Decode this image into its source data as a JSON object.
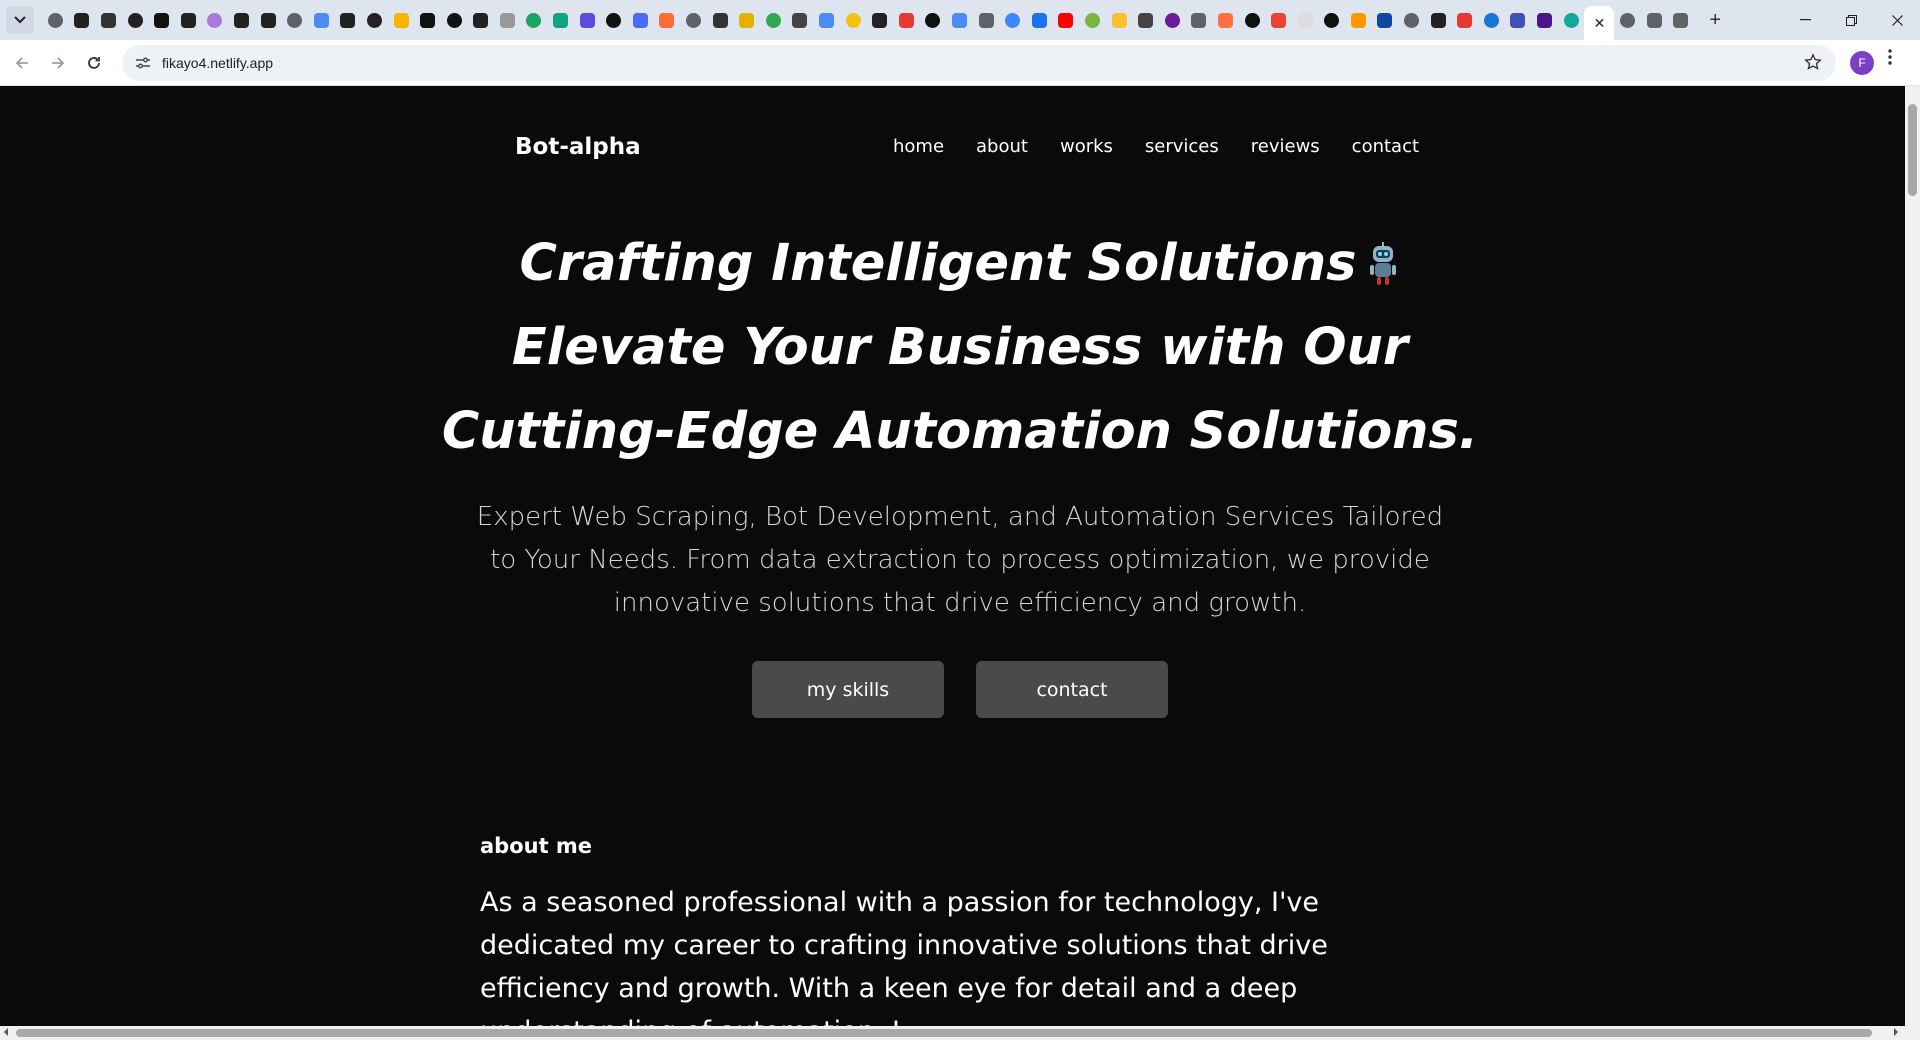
{
  "browser": {
    "url": "fikayo4.netlify.app",
    "tab_close_glyph": "✕",
    "new_tab_glyph": "+",
    "profile_initial": "F",
    "tab_icon_colors": [
      "#5f6368",
      "#222222",
      "#333333",
      "#222222",
      "#111111",
      "#222222",
      "#a97bd8",
      "#222222",
      "#222222",
      "#5f6368",
      "#4c8bf5",
      "#222222",
      "#222222",
      "#f4b400",
      "#111111",
      "#111111",
      "#222222",
      "#999999",
      "#1ea362",
      "#10a37f",
      "#5b4cdb",
      "#111111",
      "#4c6bf5",
      "#ff6b35",
      "#5f6368",
      "#333333",
      "#e5b000",
      "#34a853",
      "#444444",
      "#4c8bf5",
      "#f1c40f",
      "#222222",
      "#e53935",
      "#111111",
      "#4c8bf5",
      "#5f6368",
      "#4285f4",
      "#1a73e8",
      "#ff0000",
      "#7cb342",
      "#fbc02d",
      "#444444",
      "#6a1b9a",
      "#5f6368",
      "#ff7043",
      "#111111",
      "#ea4335",
      "#dddddd",
      "#111111",
      "#ff9800",
      "#0d47a1",
      "#5f6368",
      "#222222",
      "#e53935",
      "#1976d2",
      "#3f51b5",
      "#4a148c",
      "#13a89e"
    ],
    "extra_tab_colors": [
      "#5f6368",
      "#5f6368",
      "#5f6368"
    ]
  },
  "site": {
    "brand": "Bot-alpha",
    "nav": [
      "home",
      "about",
      "works",
      "services",
      "reviews",
      "contact"
    ],
    "hero": {
      "line1": "Crafting Intelligent Solutions",
      "line2": "Elevate Your Business with Our",
      "line3": "Cutting-Edge Automation Solutions.",
      "robot_emoji": "robot-icon"
    },
    "subtitle": "Expert Web Scraping, Bot Development, and Automation Services Tailored to Your Needs. From data extraction to process optimization, we provide innovative solutions that drive efficiency and growth.",
    "buttons": {
      "skills": "my skills",
      "contact": "contact"
    },
    "about": {
      "heading": "about me",
      "text": "As a seasoned professional with a passion for technology, I've dedicated my career to crafting innovative solutions that drive efficiency and growth. With a keen eye for detail and a deep understanding of automation, I"
    }
  }
}
